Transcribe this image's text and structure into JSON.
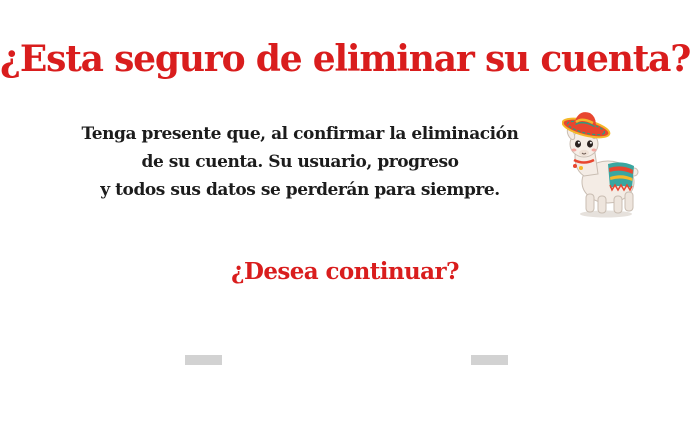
{
  "dialog": {
    "title": "¿Esta seguro de eliminar su cuenta?",
    "message_lines": [
      "Tenga presente que, al confirmar la eliminación",
      "de su cuenta. Su usuario,  progreso",
      "y todos sus datos se perderán para siempre."
    ],
    "question": "¿Desea continuar?",
    "mascot_icon": "llama-sombrero-icon",
    "buttons": [
      {
        "name": "left-action-button",
        "label": ""
      },
      {
        "name": "right-action-button",
        "label": ""
      }
    ]
  },
  "colors": {
    "accent_red": "#d91d1d",
    "text_dark": "#1c1c1c",
    "button_placeholder": "#d2d2d2",
    "background": "#ffffff"
  }
}
